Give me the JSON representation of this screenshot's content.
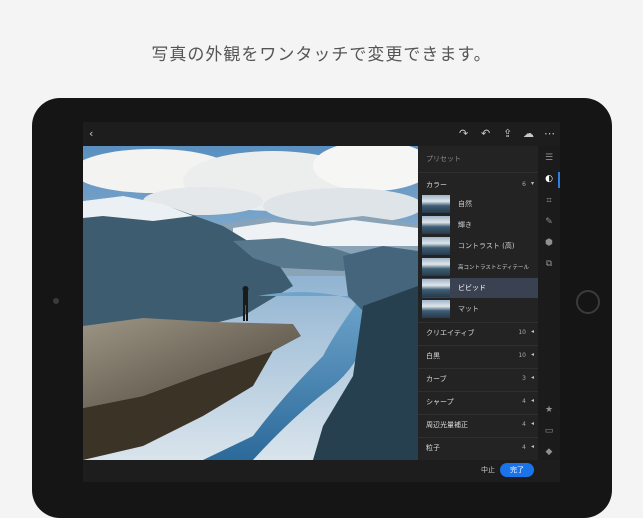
{
  "headline": "写真の外観をワンタッチで変更できます。",
  "topbar": {
    "back_icon": "chevron-left-icon",
    "redo_icon": "redo-icon",
    "undo_icon": "undo-icon",
    "share_icon": "share-icon",
    "cloud_icon": "cloud-sync-icon",
    "more_icon": "more-icon"
  },
  "panel": {
    "title": "プリセット",
    "color_category": {
      "label": "カラー",
      "count": "6",
      "arrow": "▾"
    },
    "presets": [
      {
        "label": "自然",
        "selected": false
      },
      {
        "label": "輝き",
        "selected": false
      },
      {
        "label": "コントラスト (高)",
        "selected": false
      },
      {
        "label": "高コントラストとディテール",
        "selected": false
      },
      {
        "label": "ビビッド",
        "selected": true
      },
      {
        "label": "マット",
        "selected": false
      }
    ],
    "categories": [
      {
        "label": "クリエイティブ",
        "count": "10"
      },
      {
        "label": "白黒",
        "count": "10"
      },
      {
        "label": "カーブ",
        "count": "3"
      },
      {
        "label": "シャープ",
        "count": "4"
      },
      {
        "label": "周辺光量補正",
        "count": "4"
      },
      {
        "label": "粒子",
        "count": "4"
      }
    ]
  },
  "rail": {
    "icons": [
      "sliders-icon",
      "presets-icon",
      "crop-icon",
      "brush-icon",
      "heal-icon",
      "versions-icon"
    ],
    "bottom_icons": [
      "star-icon",
      "comment-icon",
      "tag-icon",
      "info-icon"
    ]
  },
  "footer": {
    "cancel": "中止",
    "done": "完了"
  },
  "colors": {
    "accent": "#1a73e8",
    "panel_bg": "#232323",
    "screen_bg": "#1c1c1c"
  }
}
